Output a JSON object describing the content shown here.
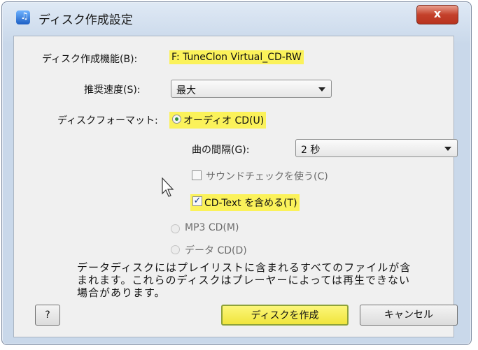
{
  "window": {
    "title": "ディスク作成設定",
    "close_glyph": "x"
  },
  "drive": {
    "label": "ディスク作成機能(B):",
    "value": "F: TuneClon Virtual_CD-RW"
  },
  "speed": {
    "label": "推奨速度(S):",
    "value": "最大"
  },
  "format": {
    "label": "ディスクフォーマット:",
    "audio_cd": {
      "label": "オーディオ CD(U)",
      "selected": true
    },
    "gap": {
      "label": "曲の間隔(G):",
      "value": "2 秒"
    },
    "soundcheck": {
      "label": "サウンドチェックを使う(C)",
      "checked": false
    },
    "cdtext": {
      "label": "CD-Text を含める(T)",
      "checked": true
    },
    "mp3_cd": {
      "label": "MP3 CD(M)",
      "selected": false
    },
    "data_cd": {
      "label": "データ CD(D)",
      "selected": false
    }
  },
  "description": "データディスクにはプレイリストに含まれるすべてのファイルが含まれます。これらのディスクはプレーヤーによっては再生できない場合があります。",
  "buttons": {
    "help": "?",
    "burn": "ディスクを作成",
    "cancel": "キャンセル"
  },
  "colors": {
    "highlight": "#fbf25a",
    "radio_selected": "#2f8d3a",
    "close_button": "#c4412b"
  }
}
